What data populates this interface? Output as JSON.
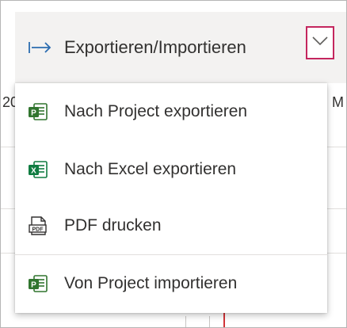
{
  "toolbar": {
    "button_label": "Exportieren/Importieren",
    "arrow_icon": "export-arrow-icon",
    "chevron_icon": "chevron-down-icon",
    "highlight_color": "#c4265e"
  },
  "background": {
    "partial_left": "20",
    "partial_right": "M"
  },
  "menu": {
    "items": [
      {
        "label": "Nach Project exportieren",
        "icon": "project-export-icon",
        "color": "#31752f"
      },
      {
        "label": "Nach Excel exportieren",
        "icon": "excel-icon",
        "color": "#107c41"
      },
      {
        "label": "PDF drucken",
        "icon": "pdf-icon",
        "color": "#323130"
      },
      {
        "label": "Von Project importieren",
        "icon": "project-import-icon",
        "color": "#31752f"
      }
    ]
  }
}
